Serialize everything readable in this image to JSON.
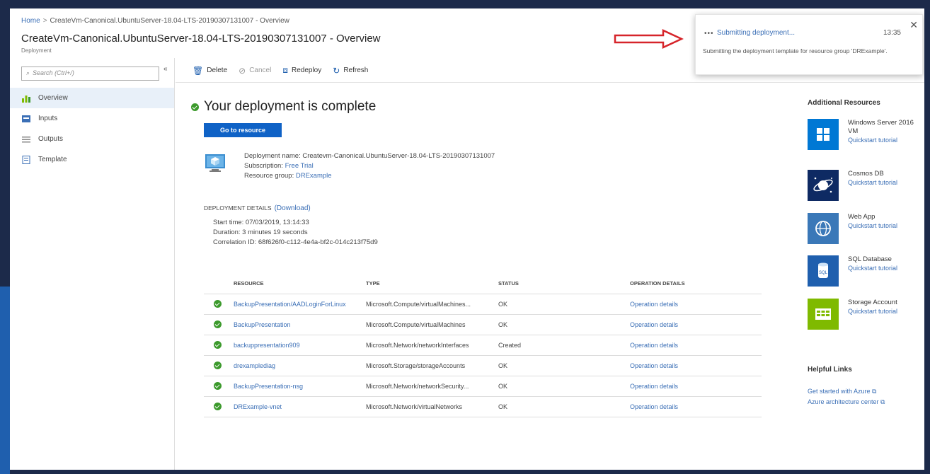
{
  "header": {
    "breadcrumb": [
      {
        "label": "Home"
      },
      {
        "label": "CreateVm-Canonical.UbuntuServer-18.04-LTS-20190307131007 - Overview"
      }
    ],
    "title": "CreateVm-Canonical.UbuntuServer-18.04-LTS-20190307131007 - Overview",
    "subtitle": "Deployment"
  },
  "notification": {
    "spinner": "•••",
    "title": "Submitting deployment...",
    "time": "13:35",
    "body": "Submitting the deployment template for resource group 'DRExample'.",
    "close": "✕"
  },
  "sidebar": {
    "search_placeholder": "Search (Ctrl+/)",
    "collapse": "«",
    "items": [
      {
        "label": "Overview",
        "icon": "overview-icon",
        "active": true
      },
      {
        "label": "Inputs",
        "icon": "inputs-icon"
      },
      {
        "label": "Outputs",
        "icon": "outputs-icon"
      },
      {
        "label": "Template",
        "icon": "template-icon"
      }
    ]
  },
  "toolbar": {
    "delete": "Delete",
    "cancel": "Cancel",
    "redeploy": "Redeploy",
    "refresh": "Refresh"
  },
  "main": {
    "complete_title": "Your deployment is complete",
    "go_to_resource": "Go to resource",
    "deployment_name_label": "Deployment name:",
    "deployment_name": "Createvm-Canonical.UbuntuServer-18.04-LTS-20190307131007",
    "subscription_label": "Subscription:",
    "subscription": "Free Trial",
    "resource_group_label": "Resource group:",
    "resource_group": "DRExample",
    "details_head": "DEPLOYMENT DETAILS",
    "download": "(Download)",
    "start_time": "Start time: 07/03/2019, 13:14:33",
    "duration": "Duration: 3 minutes 19 seconds",
    "correlation": "Correlation ID: 68f626f0-c112-4e4a-bf2c-014c213f75d9"
  },
  "table": {
    "headers": [
      "RESOURCE",
      "TYPE",
      "STATUS",
      "OPERATION DETAILS"
    ],
    "rows": [
      {
        "resource": "BackupPresentation/AADLoginForLinux",
        "type": "Microsoft.Compute/virtualMachines...",
        "status": "OK",
        "details": "Operation details"
      },
      {
        "resource": "BackupPresentation",
        "type": "Microsoft.Compute/virtualMachines",
        "status": "OK",
        "details": "Operation details"
      },
      {
        "resource": "backuppresentation909",
        "type": "Microsoft.Network/networkInterfaces",
        "status": "Created",
        "details": "Operation details"
      },
      {
        "resource": "drexamplediag",
        "type": "Microsoft.Storage/storageAccounts",
        "status": "OK",
        "details": "Operation details"
      },
      {
        "resource": "BackupPresentation-nsg",
        "type": "Microsoft.Network/networkSecurity...",
        "status": "OK",
        "details": "Operation details"
      },
      {
        "resource": "DRExample-vnet",
        "type": "Microsoft.Network/virtualNetworks",
        "status": "OK",
        "details": "Operation details"
      }
    ]
  },
  "additional": {
    "heading": "Additional Resources",
    "items": [
      {
        "name": "Windows Server 2016 VM",
        "link": "Quickstart tutorial",
        "icon": "windows-icon",
        "color": "#0078d4"
      },
      {
        "name": "Cosmos DB",
        "link": "Quickstart tutorial",
        "icon": "cosmos-db-icon",
        "color": "#0e2a63"
      },
      {
        "name": "Web App",
        "link": "Quickstart tutorial",
        "icon": "web-app-icon",
        "color": "#3a78b8"
      },
      {
        "name": "SQL Database",
        "link": "Quickstart tutorial",
        "icon": "sql-database-icon",
        "color": "#1f5fae"
      },
      {
        "name": "Storage Account",
        "link": "Quickstart tutorial",
        "icon": "storage-account-icon",
        "color": "#7fba00"
      }
    ]
  },
  "helpful": {
    "heading": "Helpful Links",
    "links": [
      "Get started with Azure ⧉",
      "Azure architecture center ⧉"
    ]
  }
}
